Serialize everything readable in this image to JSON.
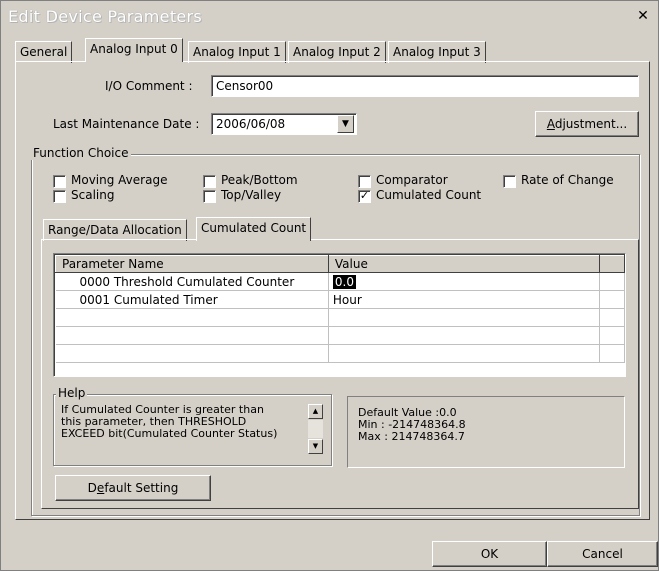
{
  "window": {
    "title": "Edit Device Parameters",
    "close_glyph": "✕"
  },
  "tabs": [
    {
      "label": "General",
      "active": false
    },
    {
      "label": "Analog Input 0",
      "active": true
    },
    {
      "label": "Analog Input 1",
      "active": false
    },
    {
      "label": "Analog Input 2",
      "active": false
    },
    {
      "label": "Analog Input 3",
      "active": false
    }
  ],
  "io_comment": {
    "label": "I/O Comment :",
    "value": "Censor00"
  },
  "maintenance": {
    "label": "Last Maintenance Date :",
    "value": "2006/06/08",
    "arrow_glyph": "▼"
  },
  "adjustment_button": {
    "label_pre": "",
    "label_acc": "A",
    "label_post": "djustment..."
  },
  "function_choice": {
    "title": "Function Choice",
    "options": [
      {
        "label": "Moving Average",
        "checked": false
      },
      {
        "label": "Scaling",
        "checked": false
      },
      {
        "label": "Peak/Bottom",
        "checked": false
      },
      {
        "label": "Top/Valley",
        "checked": false
      },
      {
        "label": "Comparator",
        "checked": false
      },
      {
        "label": "Cumulated Count",
        "checked": true
      },
      {
        "label": "Rate of Change",
        "checked": false
      }
    ]
  },
  "inner_tabs": [
    {
      "label": "Range/Data Allocation",
      "active": false
    },
    {
      "label": "Cumulated Count",
      "active": true
    }
  ],
  "parameter_table": {
    "columns": [
      "Parameter Name",
      "Value"
    ],
    "rows": [
      {
        "name": "0000 Threshold Cumulated Counter",
        "value": "0.0",
        "selected": true
      },
      {
        "name": "0001 Cumulated Timer",
        "value": "Hour",
        "selected": false
      }
    ]
  },
  "help": {
    "title": "Help",
    "text": "If Cumulated Counter is greater than\nthis parameter, then THRESHOLD\nEXCEED bit(Cumulated Counter Status)",
    "scroll_up_glyph": "▲",
    "scroll_down_glyph": "▼"
  },
  "defaults": {
    "default_value": "Default Value :0.0",
    "min": "Min : -214748364.8",
    "max": "Max : 214748364.7"
  },
  "default_setting_button": {
    "label_pre": "D",
    "label_acc": "e",
    "label_post": "fault Setting"
  },
  "ok_button": "OK",
  "cancel_button": "Cancel",
  "colors": {
    "face": "#d4d0c8",
    "shadow": "#808080",
    "highlight": "#ffffff"
  }
}
